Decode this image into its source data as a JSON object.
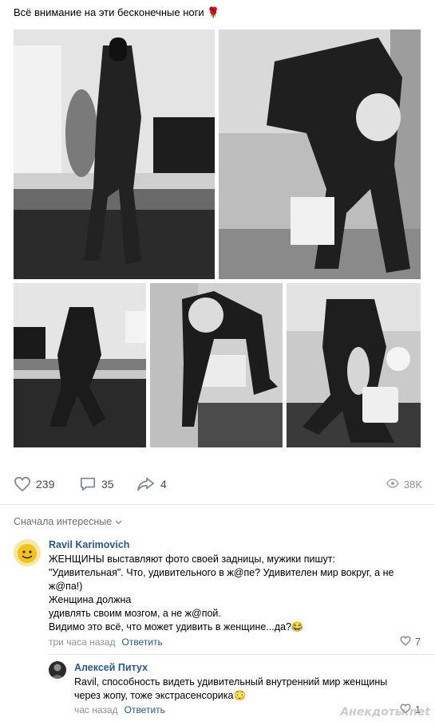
{
  "post": {
    "text": "Всё внимание на эти бесконечные ноги 🌹"
  },
  "actions": {
    "likes": "239",
    "comments": "35",
    "shares": "4",
    "views": "38K"
  },
  "comments_sort": "Сначала интересные",
  "comments": [
    {
      "author": "Ravil Karimovich",
      "lines": [
        "ЖЕНЩИНЫ выставляют фото своей задницы, мужики пишут:",
        "\"Удивительная\". Что, удивительного в ж@пе? Удивителен мир вокруг, а не",
        "ж@па!)",
        "Женщина должна",
        "удивлять своим мозгом, а не ж@пой.",
        "Видимо это всё, что может удивить в женщине...да?😂"
      ],
      "time": "три часа назад",
      "reply": "Ответить",
      "likes": "7"
    },
    {
      "author": "Алексей Питух",
      "lines": [
        "Ravil, способность видеть удивительный внутренний мир женщины",
        "через жопу, тоже экстрасенсорика😳"
      ],
      "time": "час назад",
      "reply": "Ответить",
      "likes": "1"
    }
  ],
  "watermark": "Анекдоты.net"
}
